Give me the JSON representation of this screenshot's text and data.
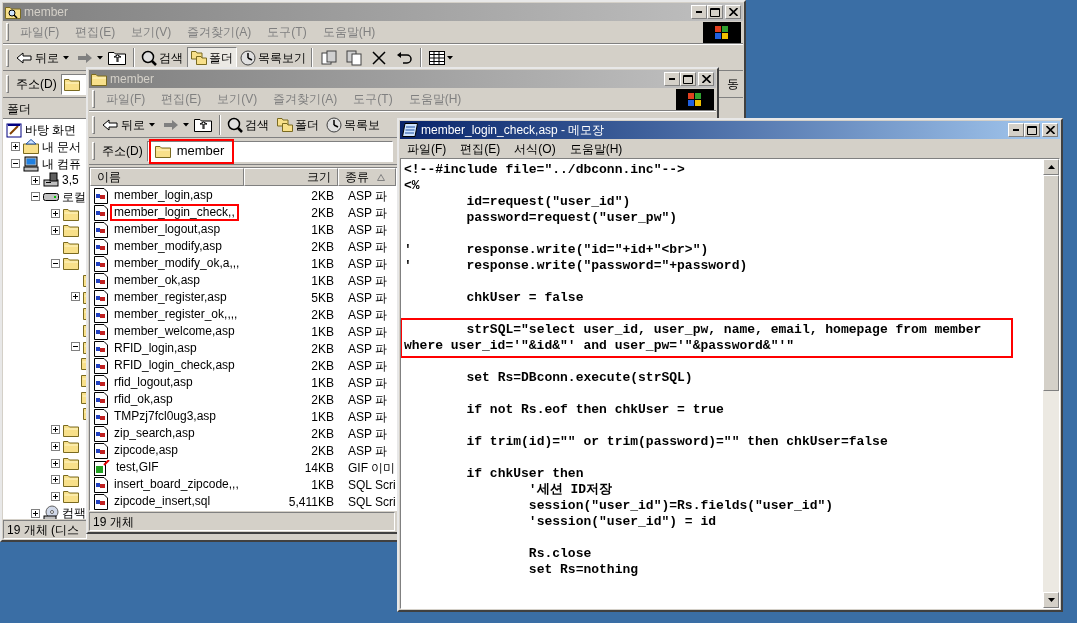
{
  "explorer_back": {
    "title": "member",
    "active": false,
    "menu": [
      "파일(F)",
      "편집(E)",
      "보기(V)",
      "즐겨찾기(A)",
      "도구(T)",
      "도움말(H)"
    ],
    "toolbar": {
      "back": "뒤로",
      "search": "검색",
      "folders": {
        "label": "폴더",
        "pressed": true
      },
      "history": "목록보기"
    },
    "address": {
      "label": "주소(D)"
    },
    "go_button": "동",
    "folder_pane": {
      "title": "폴더",
      "tree": [
        {
          "label": "바탕 화면",
          "kind": "desktop",
          "children": [
            {
              "label": "내 문서",
              "kind": "documents",
              "expanded": false
            },
            {
              "label": "내 컴퓨",
              "kind": "computer",
              "expanded": true,
              "children": [
                {
                  "label": "3,5",
                  "kind": "floppy",
                  "expanded": false
                },
                {
                  "label": "로컬",
                  "kind": "drive",
                  "expanded": true,
                  "children": [
                    {
                      "kind": "folder",
                      "expanded": false
                    },
                    {
                      "kind": "folder",
                      "expanded": false
                    },
                    {
                      "kind": "folder"
                    },
                    {
                      "kind": "folder",
                      "expanded": true,
                      "children": [
                        {
                          "kind": "folder"
                        },
                        {
                          "kind": "folder",
                          "expanded": false
                        },
                        {
                          "kind": "folder"
                        },
                        {
                          "kind": "folder"
                        },
                        {
                          "kind": "folder",
                          "expanded": true,
                          "children": [
                            {
                              "kind": "folder"
                            },
                            {
                              "kind": "folder"
                            },
                            {
                              "kind": "folder"
                            }
                          ]
                        },
                        {
                          "kind": "folder"
                        }
                      ]
                    },
                    {
                      "kind": "folder",
                      "expanded": false
                    },
                    {
                      "kind": "folder",
                      "expanded": false
                    },
                    {
                      "kind": "folder",
                      "expanded": false
                    },
                    {
                      "kind": "folder",
                      "expanded": false
                    },
                    {
                      "kind": "folder",
                      "expanded": false
                    }
                  ]
                },
                {
                  "label": "컴팩",
                  "kind": "cd",
                  "expanded": false
                }
              ]
            }
          ]
        }
      ]
    },
    "status": "19 개체 (디스"
  },
  "explorer_front": {
    "title": "member",
    "active": false,
    "menu": [
      "파일(F)",
      "편집(E)",
      "보기(V)",
      "즐겨찾기(A)",
      "도구(T)",
      "도움말(H)"
    ],
    "toolbar": {
      "back": "뒤로",
      "search": "검색",
      "folders": {
        "label": "폴더",
        "pressed": false
      },
      "history": "목록보"
    },
    "address": {
      "label": "주소(D)",
      "value": "member",
      "highlighted": true
    },
    "columns": [
      "이름",
      "크기",
      "종류"
    ],
    "files": [
      {
        "name": "member_login,asp",
        "size": "2KB",
        "type": "ASP 파",
        "kind": "script",
        "highlighted": false
      },
      {
        "name": "member_login_check,,",
        "size": "2KB",
        "type": "ASP 파",
        "kind": "script",
        "highlighted": true
      },
      {
        "name": "member_logout,asp",
        "size": "1KB",
        "type": "ASP 파",
        "kind": "script",
        "highlighted": false
      },
      {
        "name": "member_modify,asp",
        "size": "2KB",
        "type": "ASP 파",
        "kind": "script",
        "highlighted": false
      },
      {
        "name": "member_modify_ok,a,,,",
        "size": "1KB",
        "type": "ASP 파",
        "kind": "script",
        "highlighted": false
      },
      {
        "name": "member_ok,asp",
        "size": "1KB",
        "type": "ASP 파",
        "kind": "script",
        "highlighted": false
      },
      {
        "name": "member_register,asp",
        "size": "5KB",
        "type": "ASP 파",
        "kind": "script",
        "highlighted": false
      },
      {
        "name": "member_register_ok,,,,",
        "size": "2KB",
        "type": "ASP 파",
        "kind": "script",
        "highlighted": false
      },
      {
        "name": "member_welcome,asp",
        "size": "1KB",
        "type": "ASP 파",
        "kind": "script",
        "highlighted": false
      },
      {
        "name": "RFID_login,asp",
        "size": "2KB",
        "type": "ASP 파",
        "kind": "script",
        "highlighted": false
      },
      {
        "name": "RFID_login_check,asp",
        "size": "2KB",
        "type": "ASP 파",
        "kind": "script",
        "highlighted": false
      },
      {
        "name": "rfid_logout,asp",
        "size": "1KB",
        "type": "ASP 파",
        "kind": "script",
        "highlighted": false
      },
      {
        "name": "rfid_ok,asp",
        "size": "2KB",
        "type": "ASP 파",
        "kind": "script",
        "highlighted": false
      },
      {
        "name": "TMPzj7fcl0ug3,asp",
        "size": "1KB",
        "type": "ASP 파",
        "kind": "script",
        "highlighted": false
      },
      {
        "name": "zip_search,asp",
        "size": "2KB",
        "type": "ASP 파",
        "kind": "script",
        "highlighted": false
      },
      {
        "name": "zipcode,asp",
        "size": "2KB",
        "type": "ASP 파",
        "kind": "script",
        "highlighted": false
      },
      {
        "name": "test,GIF",
        "size": "14KB",
        "type": "GIF 이미",
        "kind": "image",
        "highlighted": false
      },
      {
        "name": "insert_board_zipcode,,,",
        "size": "1KB",
        "type": "SQL Scri",
        "kind": "script",
        "highlighted": false
      },
      {
        "name": "zipcode_insert,sql",
        "size": "5,411KB",
        "type": "SQL Scri",
        "kind": "script",
        "highlighted": false
      }
    ],
    "status": "19 개체"
  },
  "notepad": {
    "title": "member_login_check,asp - 메모장",
    "active": true,
    "menu": [
      "파일(F)",
      "편집(E)",
      "서식(O)",
      "도움말(H)"
    ],
    "lines": [
      {
        "kind": "code",
        "text": "<!--#include file=\"../dbconn.inc\"-->",
        "highlighted": false
      },
      {
        "kind": "code",
        "text": "<%",
        "highlighted": false
      },
      {
        "kind": "code",
        "text": "\tid=request(\"user_id\")",
        "highlighted": false
      },
      {
        "kind": "code",
        "text": "\tpassword=request(\"user_pw\")",
        "highlighted": false
      },
      {
        "kind": "blank"
      },
      {
        "kind": "code",
        "text": "'\tresponse.write(\"id=\"+id+\"<br>\")",
        "highlighted": false
      },
      {
        "kind": "code",
        "text": "'\tresponse.write(\"password=\"+password)",
        "highlighted": false
      },
      {
        "kind": "blank"
      },
      {
        "kind": "code",
        "text": "\tchkUser = false",
        "highlighted": false
      },
      {
        "kind": "blank"
      },
      {
        "kind": "code",
        "text": "\tstrSQL=\"select user_id, user_pw, name, email, homepage from member",
        "highlighted": true
      },
      {
        "kind": "code",
        "text": "where user_id='\"&id&\"' and user_pw='\"&password&\"'\"",
        "highlighted": true
      },
      {
        "kind": "blank"
      },
      {
        "kind": "code",
        "text": "\tset Rs=DBconn.execute(strSQL)",
        "highlighted": false
      },
      {
        "kind": "blank"
      },
      {
        "kind": "code",
        "text": "\tif not Rs.eof then chkUser = true",
        "highlighted": false
      },
      {
        "kind": "blank"
      },
      {
        "kind": "code",
        "text": "\tif trim(id)=\"\" or trim(password)=\"\" then chkUser=false",
        "highlighted": false
      },
      {
        "kind": "blank"
      },
      {
        "kind": "code",
        "text": "\tif chkUser then",
        "highlighted": false
      },
      {
        "kind": "code",
        "text": "\t\t'세션 ID저장",
        "highlighted": false
      },
      {
        "kind": "code",
        "text": "\t\tsession(\"user_id\")=Rs.fields(\"user_id\")",
        "highlighted": false
      },
      {
        "kind": "code",
        "text": "\t\t'session(\"user_id\") = id",
        "highlighted": false
      },
      {
        "kind": "blank"
      },
      {
        "kind": "code",
        "text": "\t\tRs.close",
        "highlighted": false
      },
      {
        "kind": "code",
        "text": "\t\tset Rs=nothing",
        "highlighted": false
      }
    ]
  }
}
